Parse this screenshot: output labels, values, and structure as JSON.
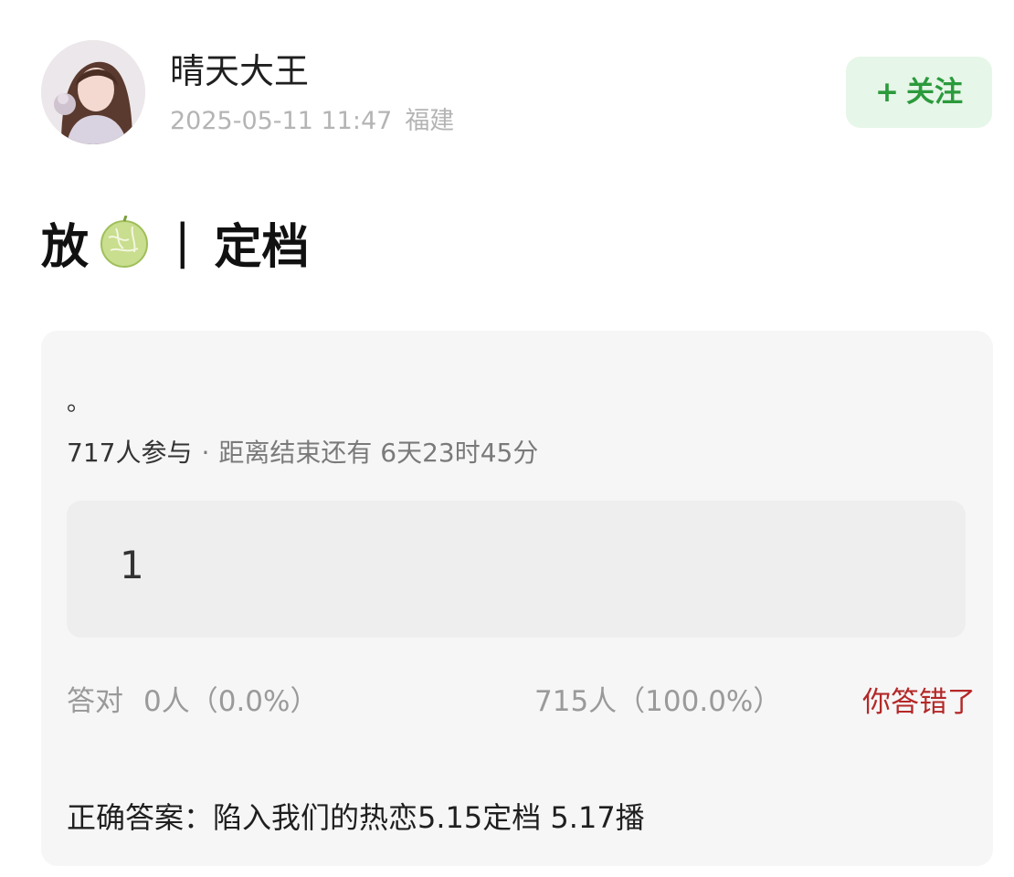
{
  "user": {
    "name": "晴天大王",
    "date": "2025-05-11 11:47",
    "location": "福建"
  },
  "follow": {
    "plus": "+",
    "label": "关注"
  },
  "post": {
    "title_left": "放",
    "separator": "|",
    "title_right": "定档"
  },
  "quiz": {
    "question": "。",
    "participants": "717人参与",
    "dot": "·",
    "countdown_label": "距离结束还有",
    "countdown_value": "6天23时45分",
    "option_text": "1",
    "correct_label": "答对",
    "correct_stat": "0人（0.0%）",
    "other_stat": "715人（100.0%）",
    "wrong_note": "你答错了",
    "answer": "正确答案：陷入我们的热恋5.15定档 5.17播"
  },
  "colors": {
    "follow_green": "#2b9a3c",
    "follow_bg": "#e6f6e8",
    "wrong_red": "#b42828",
    "card_bg": "#f6f6f6"
  },
  "icons": {
    "title_emoji": "melon-icon"
  }
}
